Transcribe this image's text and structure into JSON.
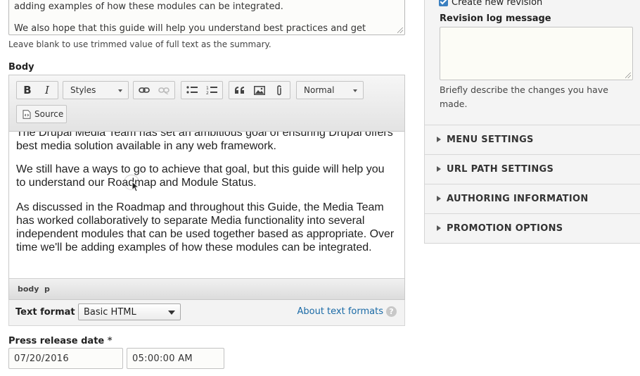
{
  "summary": {
    "line1": "adding examples of how these modules can be integrated.",
    "line2": "We also hope that this guide will help you understand best practices and get",
    "line3": "...",
    "hint": "Leave blank to use trimmed value of full text as the summary."
  },
  "body": {
    "label": "Body",
    "toolbar": {
      "bold": "B",
      "italic": "I",
      "styles_label": "Styles",
      "format_label": "Normal",
      "source_label": "Source"
    },
    "content": {
      "p1": "The Drupal Media Team has set an ambitious goal of ensuring Drupal offers best media solution available in any web framework.",
      "p2": "We still have a ways to go to achieve that goal, but this guide will help you to understand our Roadmap and Module Status.",
      "p3": "As discussed in the Roadmap and throughout this Guide, the Media Team has worked collaboratively to separate Media functionality into several independent modules that can be used together based as appropriate. Over time we'll be adding examples of how these modules can be integrated."
    },
    "path": [
      "body",
      "p"
    ]
  },
  "text_format": {
    "label": "Text format",
    "selected": "Basic HTML",
    "about_link": "About text formats",
    "help": "?"
  },
  "press_release": {
    "label": "Press release date",
    "required_mark": "*",
    "date": "07/20/2016",
    "time": "05:00:00 AM"
  },
  "sidebar": {
    "create_revision_label": "Create new revision",
    "revision_log_label": "Revision log message",
    "revision_desc": "Briefly describe the changes you have made.",
    "accordion": [
      "MENU SETTINGS",
      "URL PATH SETTINGS",
      "AUTHORING INFORMATION",
      "PROMOTION OPTIONS"
    ]
  },
  "colors": {
    "link": "#1a6aa6",
    "checkbox": "#3a7fc0",
    "sidebar_bg": "#f4f4f4"
  }
}
